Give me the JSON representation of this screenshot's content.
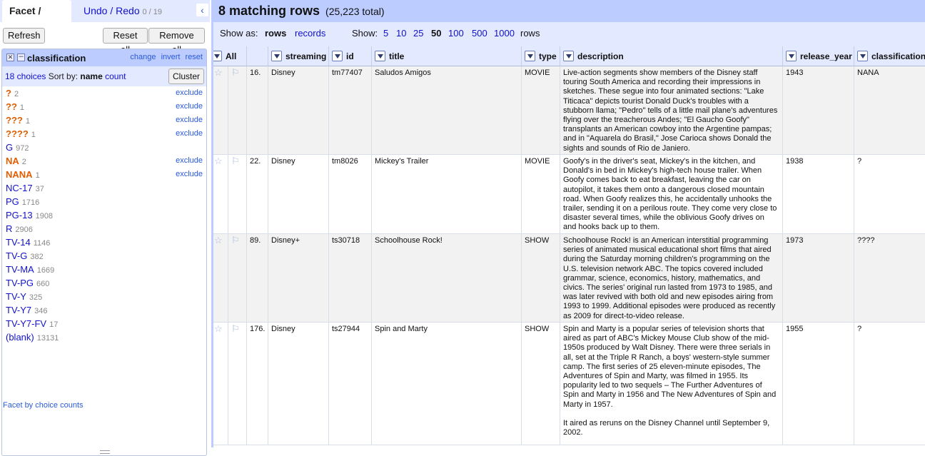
{
  "left": {
    "tabs": {
      "facet": "Facet / Filter",
      "undo": "Undo / Redo",
      "undo_count": "0 / 19"
    },
    "collapse_icon": "‹",
    "buttons": {
      "refresh": "Refresh",
      "reset_all": "Reset all",
      "remove_all": "Remove all"
    },
    "facet": {
      "title": "classification",
      "actions": [
        "change",
        "invert",
        "reset"
      ],
      "choices_label": "18 choices",
      "sort_by": "Sort by:",
      "sort_name": "name",
      "sort_count": "count",
      "cluster": "Cluster",
      "exclude_label": "exclude",
      "items": [
        {
          "name": "?",
          "count": "2",
          "selected": true
        },
        {
          "name": "??",
          "count": "1",
          "selected": true
        },
        {
          "name": "???",
          "count": "1",
          "selected": true
        },
        {
          "name": "????",
          "count": "1",
          "selected": true
        },
        {
          "name": "G",
          "count": "972",
          "selected": false
        },
        {
          "name": "NA",
          "count": "2",
          "selected": true
        },
        {
          "name": "NANA",
          "count": "1",
          "selected": true
        },
        {
          "name": "NC-17",
          "count": "37",
          "selected": false
        },
        {
          "name": "PG",
          "count": "1716",
          "selected": false
        },
        {
          "name": "PG-13",
          "count": "1908",
          "selected": false
        },
        {
          "name": "R",
          "count": "2906",
          "selected": false
        },
        {
          "name": "TV-14",
          "count": "1146",
          "selected": false
        },
        {
          "name": "TV-G",
          "count": "382",
          "selected": false
        },
        {
          "name": "TV-MA",
          "count": "1669",
          "selected": false
        },
        {
          "name": "TV-PG",
          "count": "660",
          "selected": false
        },
        {
          "name": "TV-Y",
          "count": "325",
          "selected": false
        },
        {
          "name": "TV-Y7",
          "count": "346",
          "selected": false
        },
        {
          "name": "TV-Y7-FV",
          "count": "17",
          "selected": false
        },
        {
          "name": "(blank)",
          "count": "13131",
          "selected": false
        }
      ],
      "facet_by_counts": "Facet by choice counts"
    }
  },
  "right": {
    "matching": "8 matching rows",
    "total": "(25,223 total)",
    "show_as_label": "Show as:",
    "show_as_rows": "rows",
    "show_as_records": "records",
    "show_label": "Show:",
    "page_sizes": [
      "5",
      "10",
      "25",
      "50",
      "100",
      "500",
      "1000"
    ],
    "page_size_selected": "50",
    "rows_suffix": "rows",
    "columns": {
      "all": "All",
      "streaming": "streaming",
      "id": "id",
      "title": "title",
      "type": "type",
      "description": "description",
      "release_year": "release_year",
      "classification": "classification"
    },
    "rows": [
      {
        "num": "16.",
        "streaming": "Disney",
        "id": "tm77407",
        "title": "Saludos Amigos",
        "type": "MOVIE",
        "description": "Live-action segments show members of the Disney staff touring South America and recording their impressions in sketches. These segue into four animated sections: \"Lake Titicaca\" depicts tourist Donald Duck's troubles with a stubborn llama; \"Pedro\" tells of a little mail plane's adventures flying over the treacherous Andes; \"El Gaucho Goofy\" transplants an American cowboy into the Argentine pampas; and in \"Aquarela do Brasil,\" Jose Carioca shows Donald the sights and sounds of Rio de Janiero.",
        "release_year": "1943",
        "classification": "NANA"
      },
      {
        "num": "22.",
        "streaming": "Disney",
        "id": "tm8026",
        "title": "Mickey's Trailer",
        "type": "MOVIE",
        "description": "Goofy's in the driver's seat, Mickey's in the kitchen, and Donald's in bed in Mickey's high-tech house trailer. When Goofy comes back to eat breakfast, leaving the car on autopilot, it takes them onto a dangerous closed mountain road. When Goofy realizes this, he accidentally unhooks the trailer, sending it on a perilous route. They come very close to disaster several times, while the oblivious Goofy drives on and hooks back up to them.",
        "release_year": "1938",
        "classification": "?"
      },
      {
        "num": "89.",
        "streaming": "Disney+",
        "id": "ts30718",
        "title": "Schoolhouse Rock!",
        "type": "SHOW",
        "description": "Schoolhouse Rock! is an American interstitial programming series of animated musical educational short films that aired during the Saturday morning children's programming on the U.S. television network ABC. The topics covered included grammar, science, economics, history, mathematics, and civics. The series' original run lasted from 1973 to 1985, and was later revived with both old and new episodes airing from 1993 to 1999. Additional episodes were produced as recently as 2009 for direct-to-video release.",
        "release_year": "1973",
        "classification": "????"
      },
      {
        "num": "176.",
        "streaming": "Disney",
        "id": "ts27944",
        "title": "Spin and Marty",
        "type": "SHOW",
        "description": "Spin and Marty is a popular series of television shorts that aired as part of ABC's Mickey Mouse Club show of the mid-1950s produced by Walt Disney. There were three serials in all, set at the Triple R Ranch, a boys' western-style summer camp. The first series of 25 eleven-minute episodes, The Adventures of Spin and Marty, was filmed in 1955. Its popularity led to two sequels – The Further Adventures of Spin and Marty in 1956 and The New Adventures of Spin and Marty in 1957.\n\nIt aired as reruns on the Disney Channel until September 9, 2002.",
        "release_year": "1955",
        "classification": "?"
      }
    ]
  }
}
